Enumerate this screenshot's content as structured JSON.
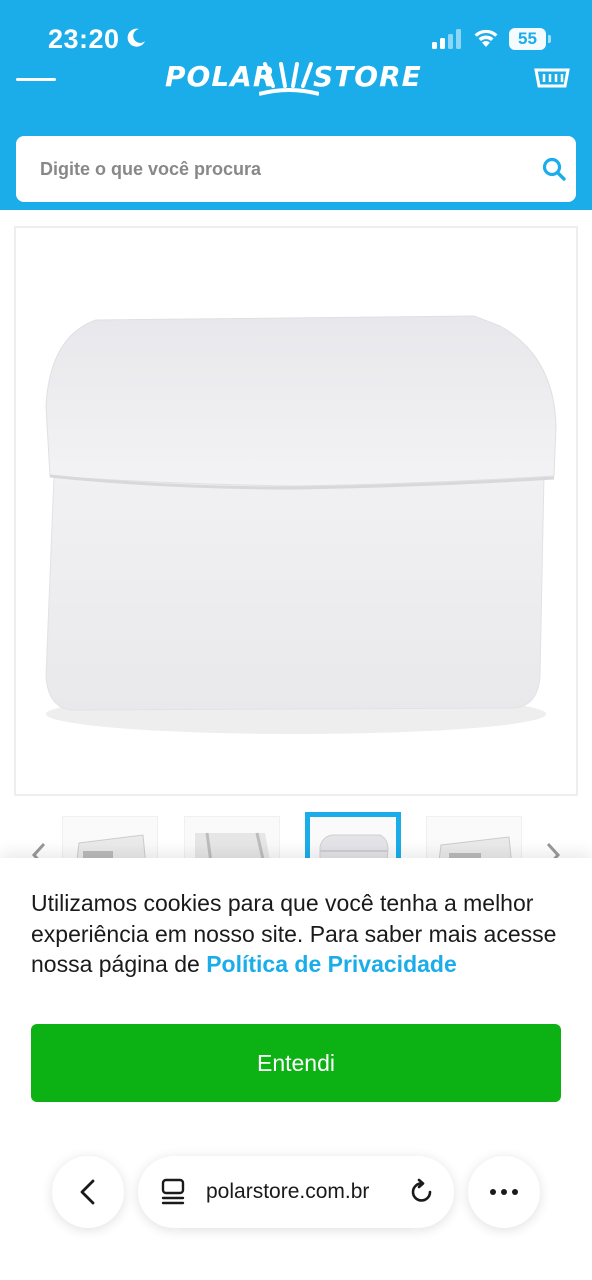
{
  "status_bar": {
    "time": "23:20",
    "battery": "55"
  },
  "header": {
    "logo_text_left": "POLAR",
    "logo_text_right": "STORE",
    "brand_color": "#1badea"
  },
  "search": {
    "placeholder": "Digite o que você procura",
    "value": ""
  },
  "product": {
    "image_icon": "styrofoam-box-image",
    "thumbnails": [
      {
        "icon": "box-with-label-image",
        "active": false
      },
      {
        "icon": "box-side-image",
        "active": false
      },
      {
        "icon": "box-front-image",
        "active": true
      },
      {
        "icon": "box-with-label-image",
        "active": false
      }
    ]
  },
  "cookie_banner": {
    "text": "Utilizamos cookies para que você tenha a melhor experiência em nosso site. Para saber mais acesse nossa página de ",
    "link_label": "Política de Privacidade",
    "button_label": "Entendi",
    "button_color": "#0cb213",
    "link_color": "#1badea"
  },
  "browser": {
    "url": "polarstore.com.br",
    "icons": [
      "chevron-left-icon",
      "tab-icon",
      "reload-icon",
      "more-icon"
    ]
  }
}
